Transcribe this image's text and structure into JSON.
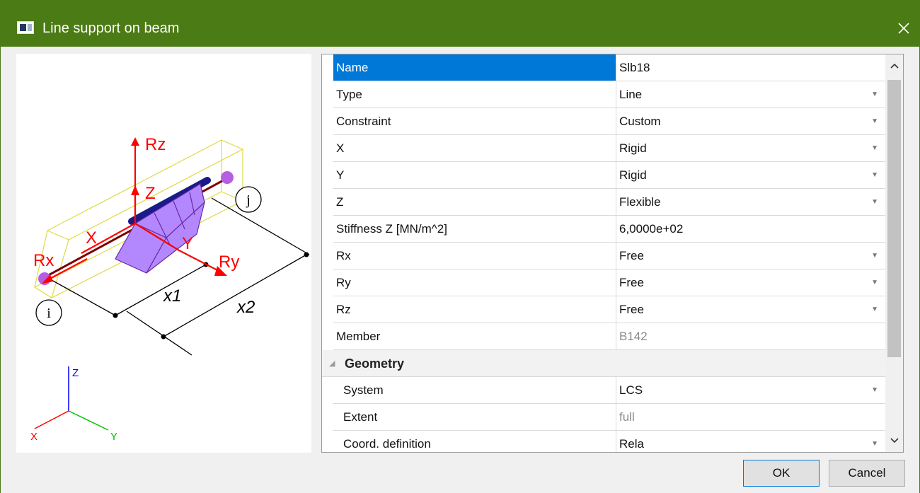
{
  "window": {
    "title": "Line support on beam",
    "close_label": "✕"
  },
  "preview": {
    "labels": {
      "rz": "Rz",
      "z": "Z",
      "x": "X",
      "y": "Y",
      "rx": "Rx",
      "ry": "Ry",
      "x1": "x1",
      "x2": "x2",
      "i": "i",
      "j": "j"
    },
    "axes": {
      "z": "Z",
      "x": "X",
      "y": "Y"
    }
  },
  "grid": {
    "rows": [
      {
        "name": "Name",
        "value": "Slb18",
        "dropdown": false,
        "selected": true
      },
      {
        "name": "Type",
        "value": "Line",
        "dropdown": true
      },
      {
        "name": "Constraint",
        "value": "Custom",
        "dropdown": true
      },
      {
        "name": "X",
        "value": "Rigid",
        "dropdown": true
      },
      {
        "name": "Y",
        "value": "Rigid",
        "dropdown": true
      },
      {
        "name": "Z",
        "value": "Flexible",
        "dropdown": true
      },
      {
        "name": "Stiffness Z [MN/m^2]",
        "value": "6,0000e+02",
        "dropdown": false
      },
      {
        "name": "Rx",
        "value": "Free",
        "dropdown": true
      },
      {
        "name": "Ry",
        "value": "Free",
        "dropdown": true
      },
      {
        "name": "Rz",
        "value": "Free",
        "dropdown": true
      },
      {
        "name": "Member",
        "value": "B142",
        "dropdown": false,
        "readonly": true
      }
    ],
    "category": {
      "label": "Geometry"
    },
    "geometry_rows": [
      {
        "name": "System",
        "value": "LCS",
        "dropdown": true
      },
      {
        "name": "Extent",
        "value": "full",
        "dropdown": false,
        "readonly": true
      },
      {
        "name": "Coord. definition",
        "value": "Rela",
        "dropdown": true
      }
    ]
  },
  "buttons": {
    "ok": "OK",
    "cancel": "Cancel"
  },
  "colors": {
    "titlebar": "#4b7b14",
    "selection": "#0078d7",
    "support": "#b388ff",
    "annotation": "#ff0000"
  }
}
